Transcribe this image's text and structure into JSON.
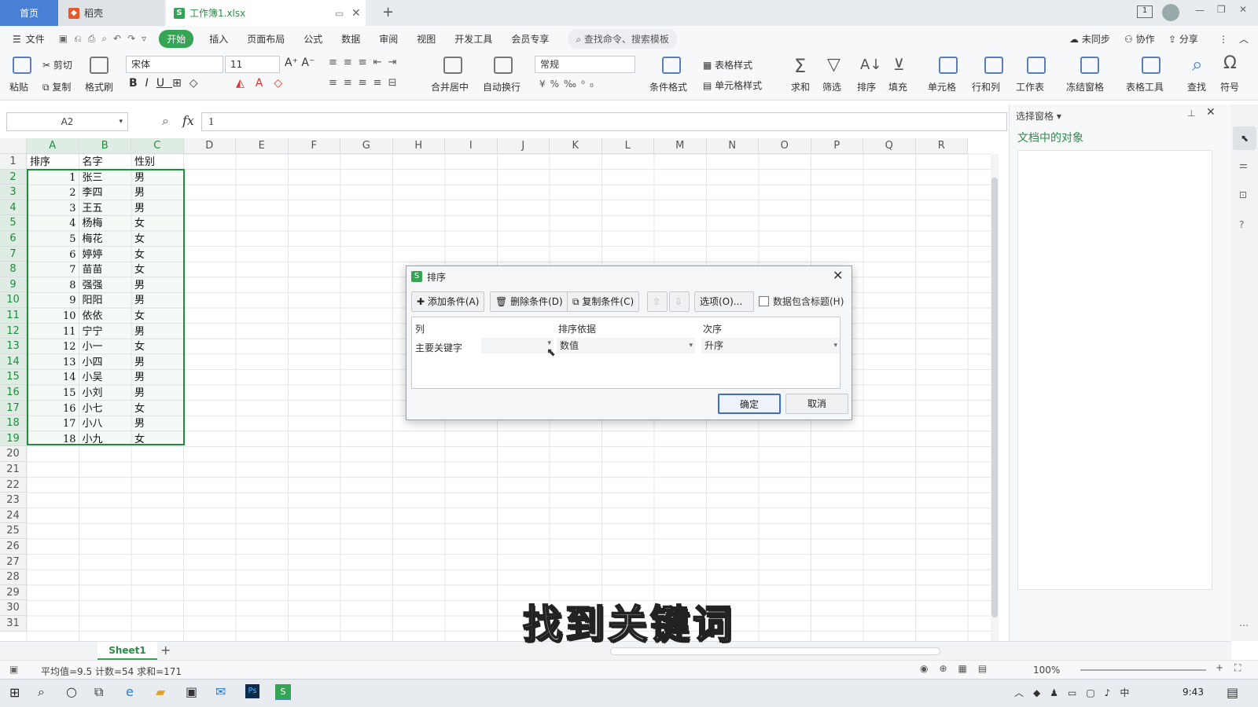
{
  "tabs": {
    "home": "首页",
    "daoke": "稻壳",
    "workbook": "工作簿1.xlsx"
  },
  "menu": {
    "file": "文件",
    "items": [
      "开始",
      "插入",
      "页面布局",
      "公式",
      "数据",
      "审阅",
      "视图",
      "开发工具",
      "会员专享"
    ],
    "search": "查找命令、搜索模板",
    "right": [
      "未同步",
      "协作",
      "分享"
    ]
  },
  "ribbon": {
    "paste": "粘贴",
    "cut": "剪切",
    "copy": "复制",
    "format_painter": "格式刷",
    "font_name": "宋体",
    "font_size": "11",
    "merge_center": "合并居中",
    "auto_wrap": "自动换行",
    "number_format": "常规",
    "conditional_format": "条件格式",
    "table_style": "表格样式",
    "cell_style": "单元格样式",
    "sum": "求和",
    "filter": "筛选",
    "sort": "排序",
    "fill": "填充",
    "cell": "单元格",
    "row_col": "行和列",
    "worksheet": "工作表",
    "freeze": "冻结窗格",
    "table_tools": "表格工具",
    "find": "查找",
    "symbol": "符号"
  },
  "formula_bar": {
    "name_box": "A2",
    "fx": "fx",
    "value": "1"
  },
  "columns": [
    "A",
    "B",
    "C",
    "D",
    "E",
    "F",
    "G",
    "H",
    "I",
    "J",
    "K",
    "L",
    "M",
    "N",
    "O",
    "P",
    "Q",
    "R"
  ],
  "header_row": [
    "排序",
    "名字",
    "性别"
  ],
  "rows": [
    {
      "n": "1",
      "name": "张三",
      "sex": "男"
    },
    {
      "n": "2",
      "name": "李四",
      "sex": "男"
    },
    {
      "n": "3",
      "name": "王五",
      "sex": "男"
    },
    {
      "n": "4",
      "name": "杨梅",
      "sex": "女"
    },
    {
      "n": "5",
      "name": "梅花",
      "sex": "女"
    },
    {
      "n": "6",
      "name": "婷婷",
      "sex": "女"
    },
    {
      "n": "7",
      "name": "苗苗",
      "sex": "女"
    },
    {
      "n": "8",
      "name": "强强",
      "sex": "男"
    },
    {
      "n": "9",
      "name": "阳阳",
      "sex": "男"
    },
    {
      "n": "10",
      "name": "依依",
      "sex": "女"
    },
    {
      "n": "11",
      "name": "宁宁",
      "sex": "男"
    },
    {
      "n": "12",
      "name": "小一",
      "sex": "女"
    },
    {
      "n": "13",
      "name": "小四",
      "sex": "男"
    },
    {
      "n": "14",
      "name": "小吴",
      "sex": "男"
    },
    {
      "n": "15",
      "name": "小刘",
      "sex": "男"
    },
    {
      "n": "16",
      "name": "小七",
      "sex": "女"
    },
    {
      "n": "17",
      "name": "小八",
      "sex": "男"
    },
    {
      "n": "18",
      "name": "小九",
      "sex": "女"
    }
  ],
  "row_numbers": [
    "1",
    "2",
    "3",
    "4",
    "5",
    "6",
    "7",
    "8",
    "9",
    "10",
    "11",
    "12",
    "13",
    "14",
    "15",
    "16",
    "17",
    "18",
    "19",
    "20",
    "21",
    "22",
    "23",
    "24",
    "25",
    "26",
    "27",
    "28",
    "29",
    "30",
    "31"
  ],
  "right_pane": {
    "title": "选择窗格",
    "section": "文档中的对象"
  },
  "sheet_tab": "Sheet1",
  "status": {
    "summary": "平均值=9.5  计数=54  求和=171",
    "zoom": "100%"
  },
  "taskbar": {
    "time": "9:43"
  },
  "dialog": {
    "title": "排序",
    "add": "添加条件(A)",
    "delete": "删除条件(D)",
    "copy": "复制条件(C)",
    "options": "选项(O)...",
    "has_header": "数据包含标题(H)",
    "col_header": "列",
    "basis_header": "排序依据",
    "order_header": "次序",
    "primary_key": "主要关键字",
    "basis_value": "数值",
    "order_value": "升序",
    "ok": "确定",
    "cancel": "取消"
  },
  "subtitle": "找到关键词",
  "colors": {
    "accent": "#35a455",
    "selection": "#1f8c3b",
    "tab_blue": "#4a7fd6"
  }
}
